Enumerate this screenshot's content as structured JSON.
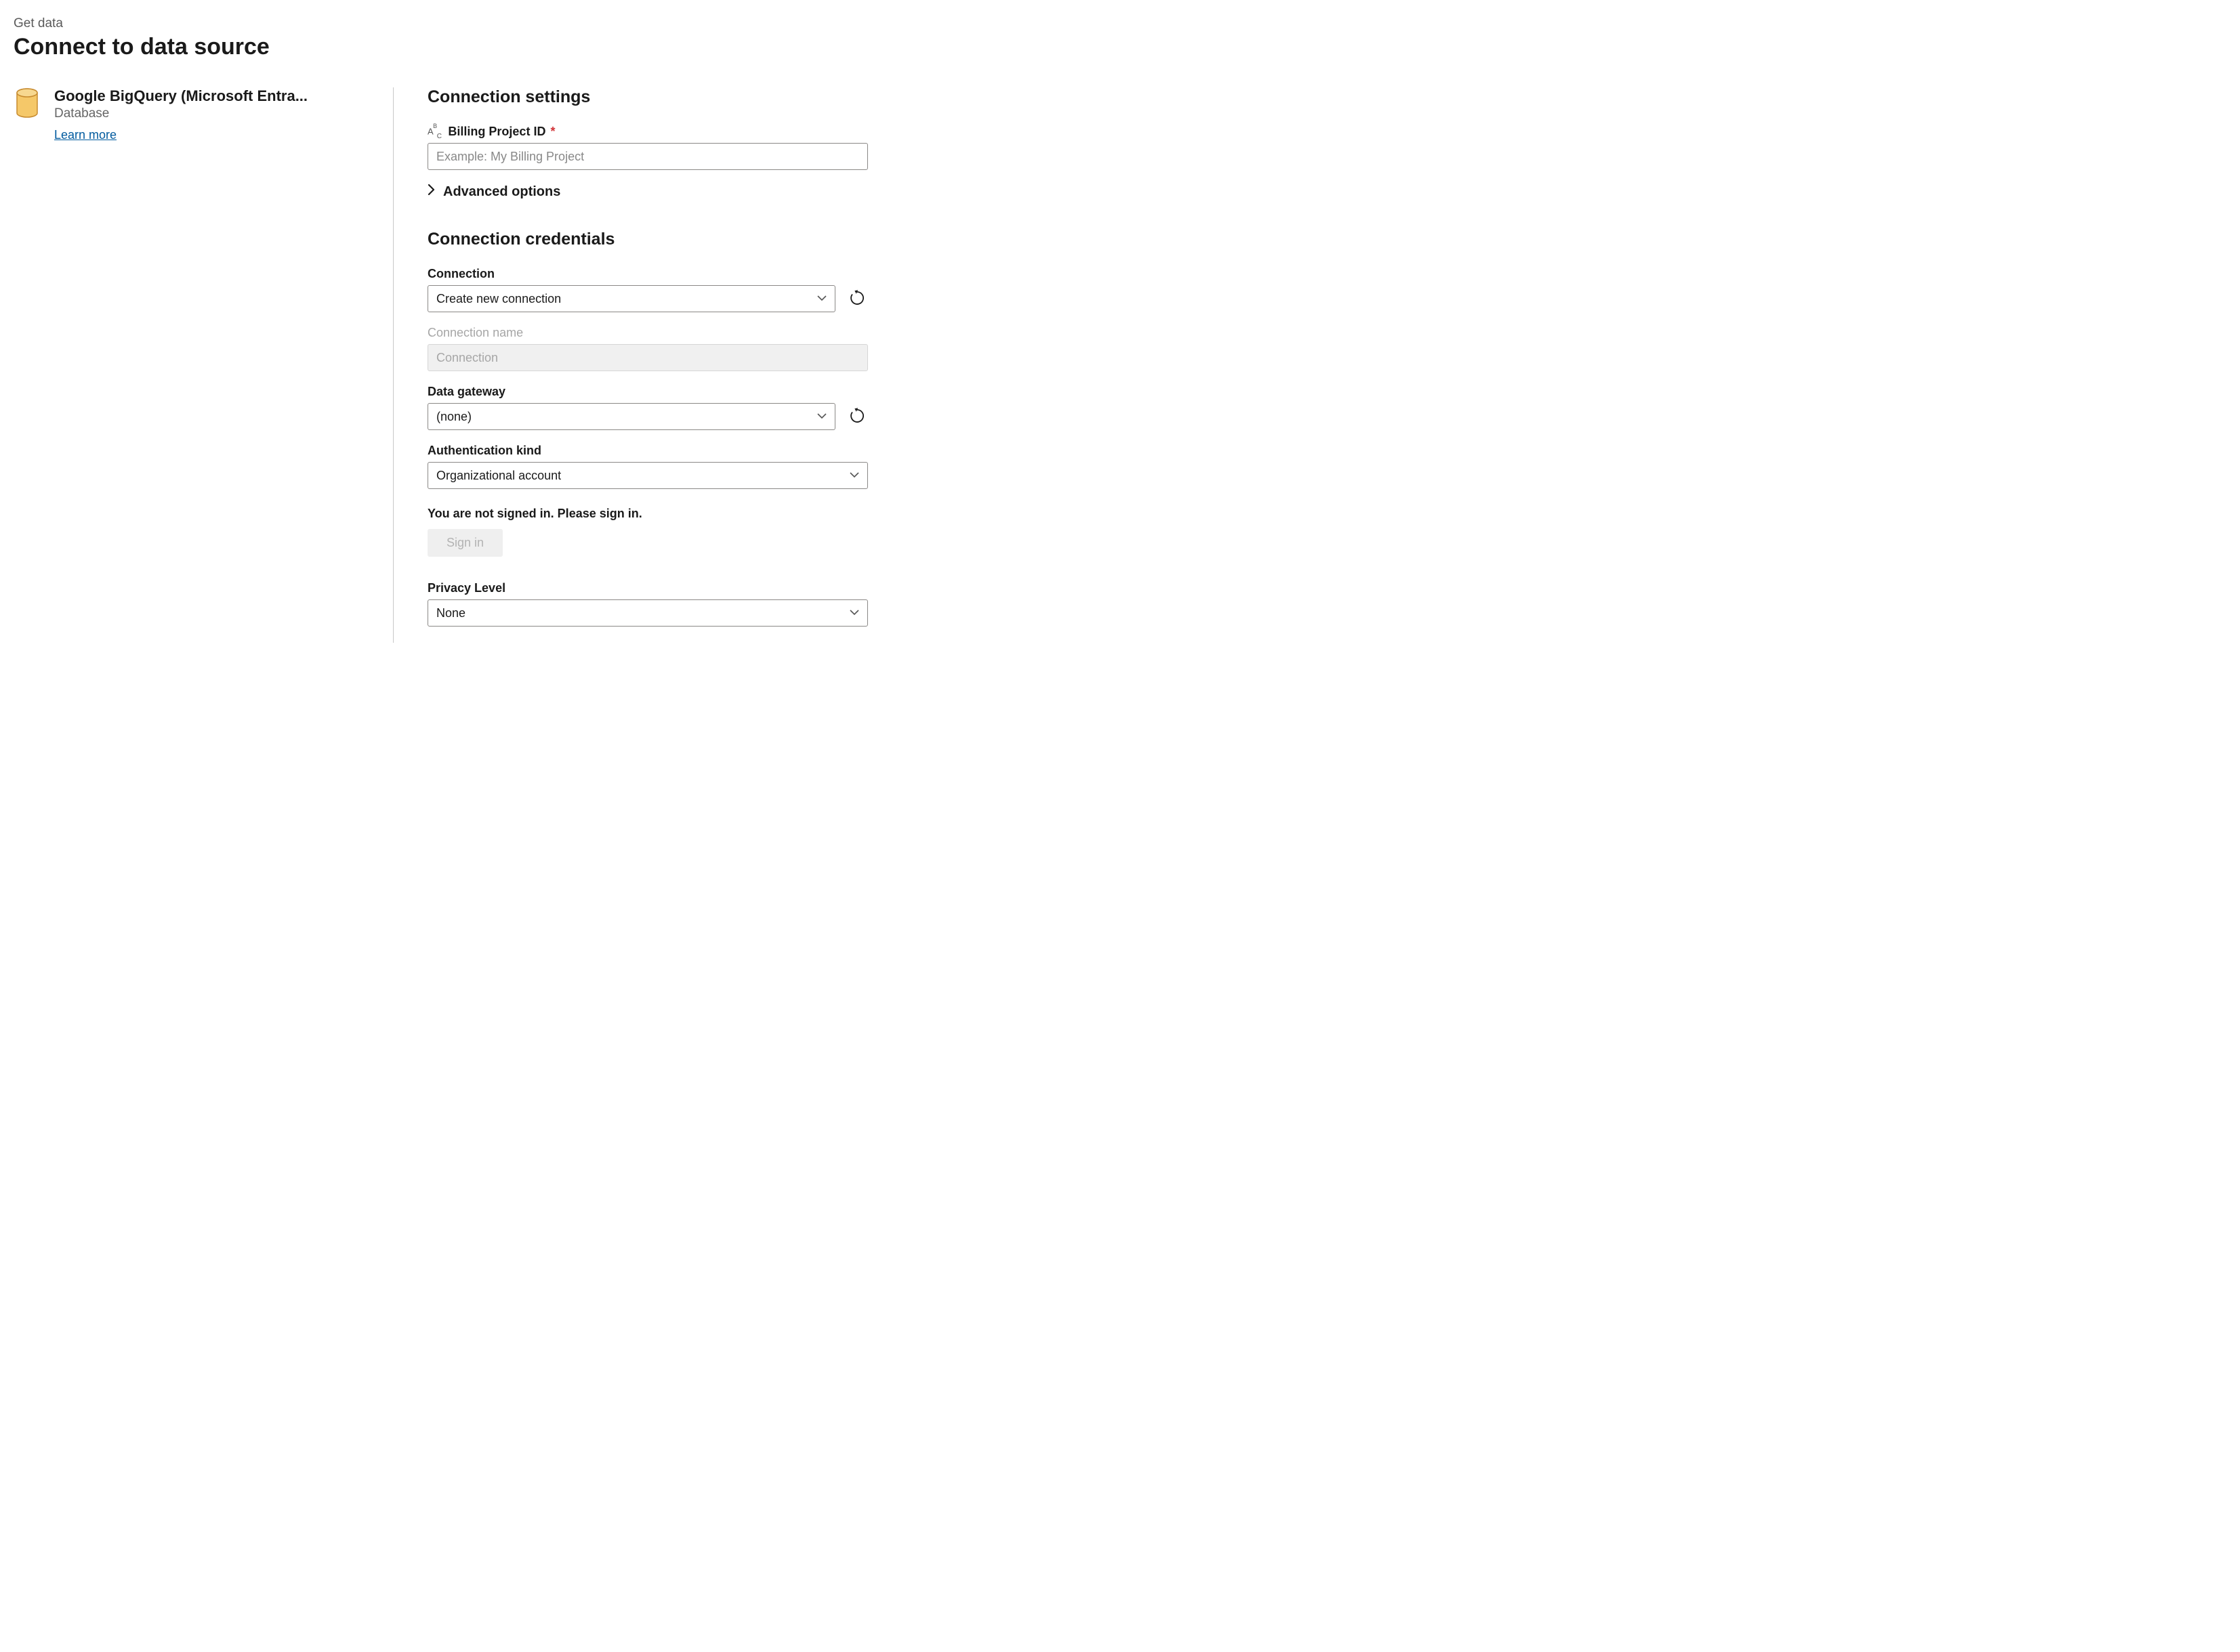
{
  "header": {
    "subtitle": "Get data",
    "title": "Connect to data source"
  },
  "connector": {
    "title": "Google BigQuery (Microsoft Entra...",
    "category": "Database",
    "learn_more": "Learn more"
  },
  "settings": {
    "heading": "Connection settings",
    "billing": {
      "label": "Billing Project ID",
      "required_marker": "*",
      "placeholder": "Example: My Billing Project",
      "value": ""
    },
    "advanced_label": "Advanced options"
  },
  "credentials": {
    "heading": "Connection credentials",
    "connection": {
      "label": "Connection",
      "value": "Create new connection"
    },
    "connection_name": {
      "label": "Connection name",
      "value": "Connection"
    },
    "gateway": {
      "label": "Data gateway",
      "value": "(none)"
    },
    "auth": {
      "label": "Authentication kind",
      "value": "Organizational account"
    },
    "signin_msg": "You are not signed in. Please sign in.",
    "signin_btn": "Sign in",
    "privacy": {
      "label": "Privacy Level",
      "value": "None"
    }
  }
}
